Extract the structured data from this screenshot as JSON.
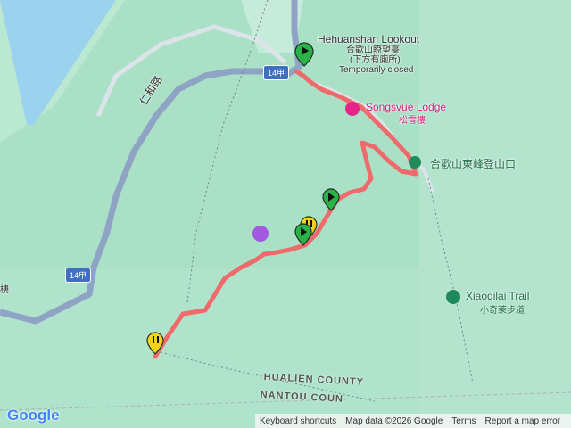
{
  "map": {
    "pois": {
      "lookout": {
        "name": "Hehuanshan Lookout",
        "name_zh": "合歡山瞭望臺",
        "note_zh": "(下方有廁所)",
        "status": "Temporarily closed"
      },
      "lodge": {
        "name": "Songsvue Lodge",
        "name_zh": "松雪樓"
      },
      "trailhead": {
        "name_zh": "合歡山東峰登山口"
      },
      "xiaoqilai": {
        "name": "Xiaoqilai Trail",
        "name_zh": "小奇萊步道"
      },
      "edge_label": "樓"
    },
    "roads": {
      "renhe": "仁和路",
      "route_shield": "14甲"
    },
    "counties": {
      "hualien": "HUALIEN COUNTY",
      "nantou": "NANTOU COUN"
    },
    "colors": {
      "terrain": "#a9e0c6",
      "track": "#ef6a6a",
      "road": "#8fa3c5",
      "marker_green": "#2bb34a",
      "marker_yellow": "#f2d21b"
    }
  },
  "branding": {
    "logo": "Google"
  },
  "attribution": {
    "keyboard": "Keyboard shortcuts",
    "data": "Map data ©2026 Google",
    "terms": "Terms",
    "report": "Report a map error"
  }
}
